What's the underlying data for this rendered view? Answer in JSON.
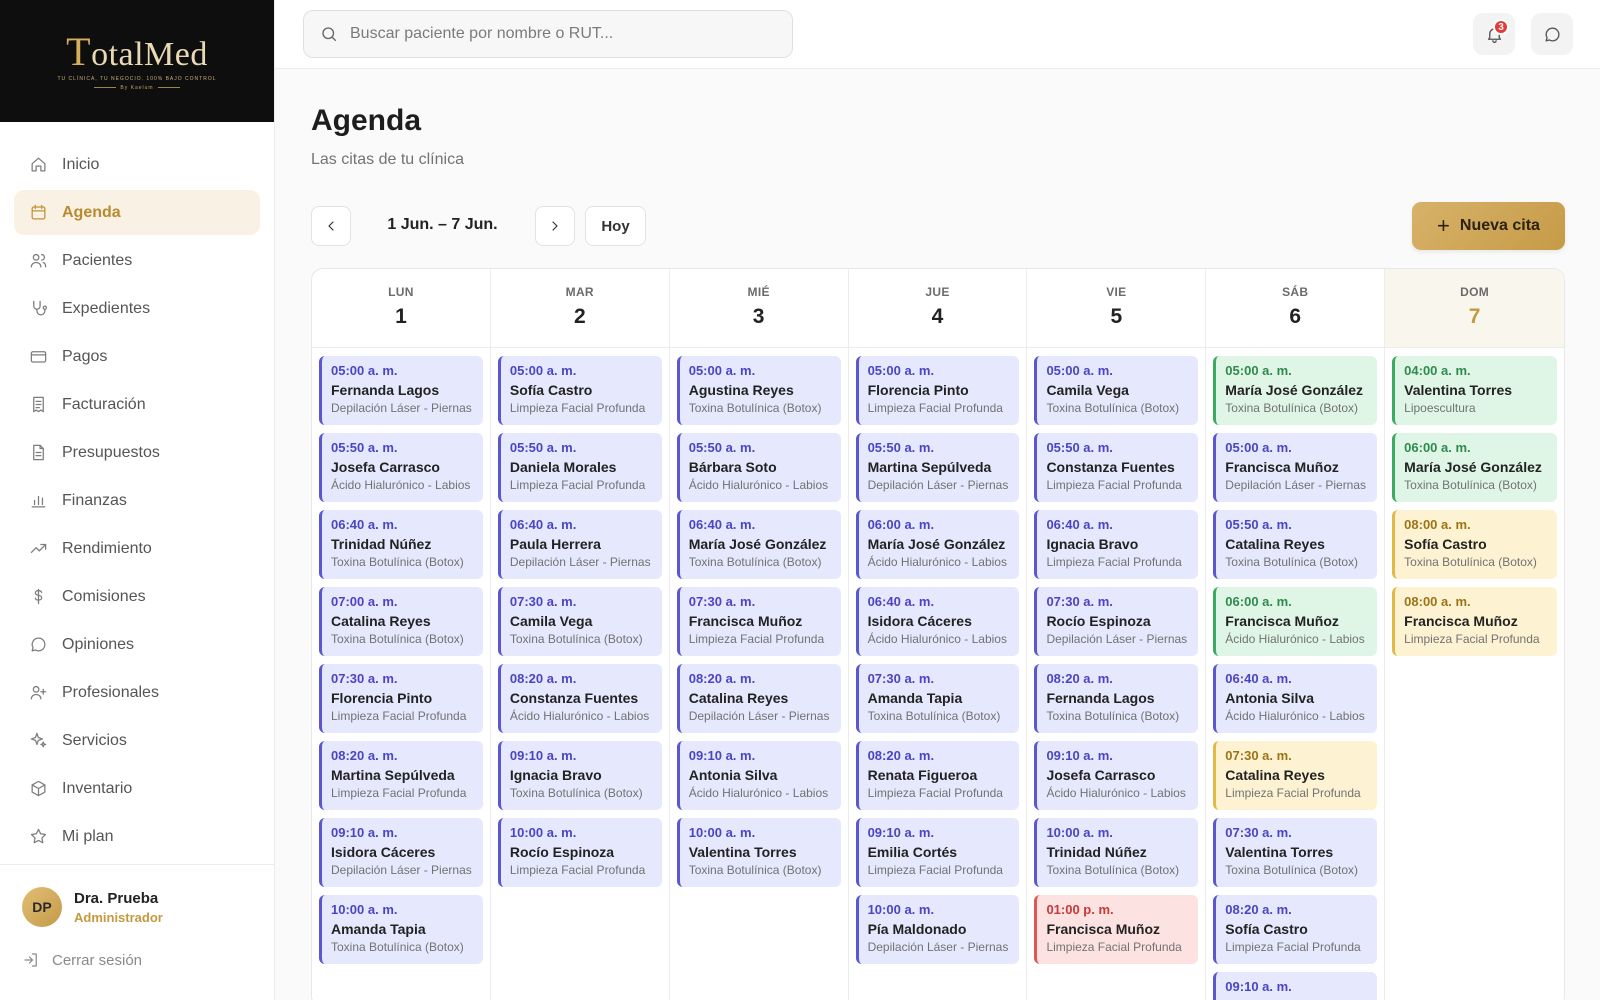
{
  "brand": {
    "logo_t": "T",
    "logo_rest": "otalMed",
    "tagline": "TU CLÍNICA, TU NEGOCIO. 100% BAJO CONTROL",
    "by": "By Kaelum"
  },
  "sidebar": {
    "items": [
      {
        "label": "Inicio",
        "icon": "home-icon"
      },
      {
        "label": "Agenda",
        "icon": "calendar-icon"
      },
      {
        "label": "Pacientes",
        "icon": "users-icon"
      },
      {
        "label": "Expedientes",
        "icon": "stethoscope-icon"
      },
      {
        "label": "Pagos",
        "icon": "credit-card-icon"
      },
      {
        "label": "Facturación",
        "icon": "receipt-icon"
      },
      {
        "label": "Presupuestos",
        "icon": "document-icon"
      },
      {
        "label": "Finanzas",
        "icon": "bar-chart-icon"
      },
      {
        "label": "Rendimiento",
        "icon": "trending-up-icon"
      },
      {
        "label": "Comisiones",
        "icon": "dollar-icon"
      },
      {
        "label": "Opiniones",
        "icon": "chat-bubble-icon"
      },
      {
        "label": "Profesionales",
        "icon": "user-plus-icon"
      },
      {
        "label": "Servicios",
        "icon": "sparkles-icon"
      },
      {
        "label": "Inventario",
        "icon": "box-icon"
      },
      {
        "label": "Mi plan",
        "icon": "star-icon"
      }
    ],
    "active_index": 1
  },
  "user": {
    "initials": "DP",
    "name": "Dra. Prueba",
    "role": "Administrador",
    "logout": "Cerrar sesión"
  },
  "header": {
    "search_placeholder": "Buscar paciente por nombre o RUT...",
    "notifications_count": "3"
  },
  "page": {
    "title": "Agenda",
    "subtitle": "Las citas de tu clínica",
    "range": "1 Jun. – 7 Jun.",
    "today_label": "Hoy",
    "new_label": "Nueva cita"
  },
  "colors": {
    "accent": "#c49a3f",
    "event_blue": "#e6e8fd",
    "event_green": "#dff6e6",
    "event_yellow": "#fdf3d3",
    "event_red": "#fde2e2"
  },
  "calendar": {
    "today_index": 6,
    "days": [
      {
        "name": "LUN",
        "num": "1",
        "events": [
          {
            "time": "05:00 a. m.",
            "patient": "Fernanda Lagos",
            "service": "Depilación Láser - Piernas",
            "color": "blue"
          },
          {
            "time": "05:50 a. m.",
            "patient": "Josefa Carrasco",
            "service": "Ácido Hialurónico - Labios",
            "color": "blue"
          },
          {
            "time": "06:40 a. m.",
            "patient": "Trinidad Núñez",
            "service": "Toxina Botulínica (Botox)",
            "color": "blue"
          },
          {
            "time": "07:00 a. m.",
            "patient": "Catalina Reyes",
            "service": "Toxina Botulínica (Botox)",
            "color": "blue"
          },
          {
            "time": "07:30 a. m.",
            "patient": "Florencia Pinto",
            "service": "Limpieza Facial Profunda",
            "color": "blue"
          },
          {
            "time": "08:20 a. m.",
            "patient": "Martina Sepúlveda",
            "service": "Limpieza Facial Profunda",
            "color": "blue"
          },
          {
            "time": "09:10 a. m.",
            "patient": "Isidora Cáceres",
            "service": "Depilación Láser - Piernas",
            "color": "blue"
          },
          {
            "time": "10:00 a. m.",
            "patient": "Amanda Tapia",
            "service": "Toxina Botulínica (Botox)",
            "color": "blue"
          }
        ]
      },
      {
        "name": "MAR",
        "num": "2",
        "events": [
          {
            "time": "05:00 a. m.",
            "patient": "Sofía Castro",
            "service": "Limpieza Facial Profunda",
            "color": "blue"
          },
          {
            "time": "05:50 a. m.",
            "patient": "Daniela Morales",
            "service": "Limpieza Facial Profunda",
            "color": "blue"
          },
          {
            "time": "06:40 a. m.",
            "patient": "Paula Herrera",
            "service": "Depilación Láser - Piernas",
            "color": "blue"
          },
          {
            "time": "07:30 a. m.",
            "patient": "Camila Vega",
            "service": "Toxina Botulínica (Botox)",
            "color": "blue"
          },
          {
            "time": "08:20 a. m.",
            "patient": "Constanza Fuentes",
            "service": "Ácido Hialurónico - Labios",
            "color": "blue"
          },
          {
            "time": "09:10 a. m.",
            "patient": "Ignacia Bravo",
            "service": "Toxina Botulínica (Botox)",
            "color": "blue"
          },
          {
            "time": "10:00 a. m.",
            "patient": "Rocío Espinoza",
            "service": "Limpieza Facial Profunda",
            "color": "blue"
          }
        ]
      },
      {
        "name": "MIÉ",
        "num": "3",
        "events": [
          {
            "time": "05:00 a. m.",
            "patient": "Agustina Reyes",
            "service": "Toxina Botulínica (Botox)",
            "color": "blue"
          },
          {
            "time": "05:50 a. m.",
            "patient": "Bárbara Soto",
            "service": "Ácido Hialurónico - Labios",
            "color": "blue"
          },
          {
            "time": "06:40 a. m.",
            "patient": "María José González",
            "service": "Toxina Botulínica (Botox)",
            "color": "blue"
          },
          {
            "time": "07:30 a. m.",
            "patient": "Francisca Muñoz",
            "service": "Limpieza Facial Profunda",
            "color": "blue"
          },
          {
            "time": "08:20 a. m.",
            "patient": "Catalina Reyes",
            "service": "Depilación Láser - Piernas",
            "color": "blue"
          },
          {
            "time": "09:10 a. m.",
            "patient": "Antonia Silva",
            "service": "Ácido Hialurónico - Labios",
            "color": "blue"
          },
          {
            "time": "10:00 a. m.",
            "patient": "Valentina Torres",
            "service": "Toxina Botulínica (Botox)",
            "color": "blue"
          }
        ]
      },
      {
        "name": "JUE",
        "num": "4",
        "events": [
          {
            "time": "05:00 a. m.",
            "patient": "Florencia Pinto",
            "service": "Limpieza Facial Profunda",
            "color": "blue"
          },
          {
            "time": "05:50 a. m.",
            "patient": "Martina Sepúlveda",
            "service": "Depilación Láser - Piernas",
            "color": "blue"
          },
          {
            "time": "06:00 a. m.",
            "patient": "María José González",
            "service": "Ácido Hialurónico - Labios",
            "color": "blue"
          },
          {
            "time": "06:40 a. m.",
            "patient": "Isidora Cáceres",
            "service": "Ácido Hialurónico - Labios",
            "color": "blue"
          },
          {
            "time": "07:30 a. m.",
            "patient": "Amanda Tapia",
            "service": "Toxina Botulínica (Botox)",
            "color": "blue"
          },
          {
            "time": "08:20 a. m.",
            "patient": "Renata Figueroa",
            "service": "Limpieza Facial Profunda",
            "color": "blue"
          },
          {
            "time": "09:10 a. m.",
            "patient": "Emilia Cortés",
            "service": "Limpieza Facial Profunda",
            "color": "blue"
          },
          {
            "time": "10:00 a. m.",
            "patient": "Pía Maldonado",
            "service": "Depilación Láser - Piernas",
            "color": "blue"
          }
        ]
      },
      {
        "name": "VIE",
        "num": "5",
        "events": [
          {
            "time": "05:00 a. m.",
            "patient": "Camila Vega",
            "service": "Toxina Botulínica (Botox)",
            "color": "blue"
          },
          {
            "time": "05:50 a. m.",
            "patient": "Constanza Fuentes",
            "service": "Limpieza Facial Profunda",
            "color": "blue"
          },
          {
            "time": "06:40 a. m.",
            "patient": "Ignacia Bravo",
            "service": "Limpieza Facial Profunda",
            "color": "blue"
          },
          {
            "time": "07:30 a. m.",
            "patient": "Rocío Espinoza",
            "service": "Depilación Láser - Piernas",
            "color": "blue"
          },
          {
            "time": "08:20 a. m.",
            "patient": "Fernanda Lagos",
            "service": "Toxina Botulínica (Botox)",
            "color": "blue"
          },
          {
            "time": "09:10 a. m.",
            "patient": "Josefa Carrasco",
            "service": "Ácido Hialurónico - Labios",
            "color": "blue"
          },
          {
            "time": "10:00 a. m.",
            "patient": "Trinidad Núñez",
            "service": "Toxina Botulínica (Botox)",
            "color": "blue"
          },
          {
            "time": "01:00 p. m.",
            "patient": "Francisca Muñoz",
            "service": "Limpieza Facial Profunda",
            "color": "red"
          }
        ]
      },
      {
        "name": "SÁB",
        "num": "6",
        "events": [
          {
            "time": "05:00 a. m.",
            "patient": "María José González",
            "service": "Toxina Botulínica (Botox)",
            "color": "green"
          },
          {
            "time": "05:00 a. m.",
            "patient": "Francisca Muñoz",
            "service": "Depilación Láser - Piernas",
            "color": "blue"
          },
          {
            "time": "05:50 a. m.",
            "patient": "Catalina Reyes",
            "service": "Toxina Botulínica (Botox)",
            "color": "blue"
          },
          {
            "time": "06:00 a. m.",
            "patient": "Francisca Muñoz",
            "service": "Ácido Hialurónico - Labios",
            "color": "green"
          },
          {
            "time": "06:40 a. m.",
            "patient": "Antonia Silva",
            "service": "Ácido Hialurónico - Labios",
            "color": "blue"
          },
          {
            "time": "07:30 a. m.",
            "patient": "Catalina Reyes",
            "service": "Limpieza Facial Profunda",
            "color": "yellow"
          },
          {
            "time": "07:30 a. m.",
            "patient": "Valentina Torres",
            "service": "Toxina Botulínica (Botox)",
            "color": "blue"
          },
          {
            "time": "08:20 a. m.",
            "patient": "Sofía Castro",
            "service": "Limpieza Facial Profunda",
            "color": "blue"
          },
          {
            "time": "09:10 a. m.",
            "patient": "",
            "service": "",
            "color": "blue"
          }
        ]
      },
      {
        "name": "DOM",
        "num": "7",
        "events": [
          {
            "time": "04:00 a. m.",
            "patient": "Valentina Torres",
            "service": "Lipoescultura",
            "color": "green"
          },
          {
            "time": "06:00 a. m.",
            "patient": "María José González",
            "service": "Toxina Botulínica (Botox)",
            "color": "green"
          },
          {
            "time": "08:00 a. m.",
            "patient": "Sofía Castro",
            "service": "Toxina Botulínica (Botox)",
            "color": "yellow"
          },
          {
            "time": "08:00 a. m.",
            "patient": "Francisca Muñoz",
            "service": "Limpieza Facial Profunda",
            "color": "yellow"
          }
        ]
      }
    ]
  }
}
